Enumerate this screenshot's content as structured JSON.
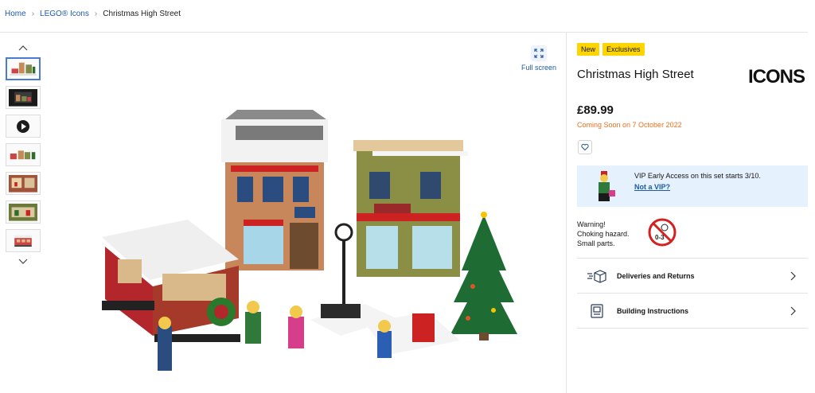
{
  "breadcrumb": {
    "home": "Home",
    "category": "LEGO® Icons",
    "current": "Christmas High Street"
  },
  "gallery": {
    "thumbnails": [
      "street-scene",
      "box-front",
      "video",
      "street-scene-wide",
      "shop-interior",
      "house-interior",
      "tram"
    ],
    "active_index": 0,
    "fullscreen_label": "Full screen"
  },
  "product": {
    "badges": [
      "New",
      "Exclusives"
    ],
    "title": "Christmas High Street",
    "brand_logo_text": "ICONS",
    "price": "£89.99",
    "availability": "Coming Soon on 7 October 2022",
    "vip_text": "VIP Early Access on this set starts 3/10.",
    "vip_link": "Not a VIP?",
    "warning_lines": [
      "Warning!",
      "Choking hazard.",
      "Small parts."
    ],
    "age_warning": "0-3",
    "accordion": [
      {
        "label": "Deliveries and Returns",
        "icon": "delivery-icon"
      },
      {
        "label": "Building Instructions",
        "icon": "instructions-icon"
      }
    ]
  },
  "colors": {
    "link": "#1e5aa8",
    "badge": "#ffd500",
    "availability": "#e7701c",
    "vip_bg": "#e5f1fc"
  }
}
